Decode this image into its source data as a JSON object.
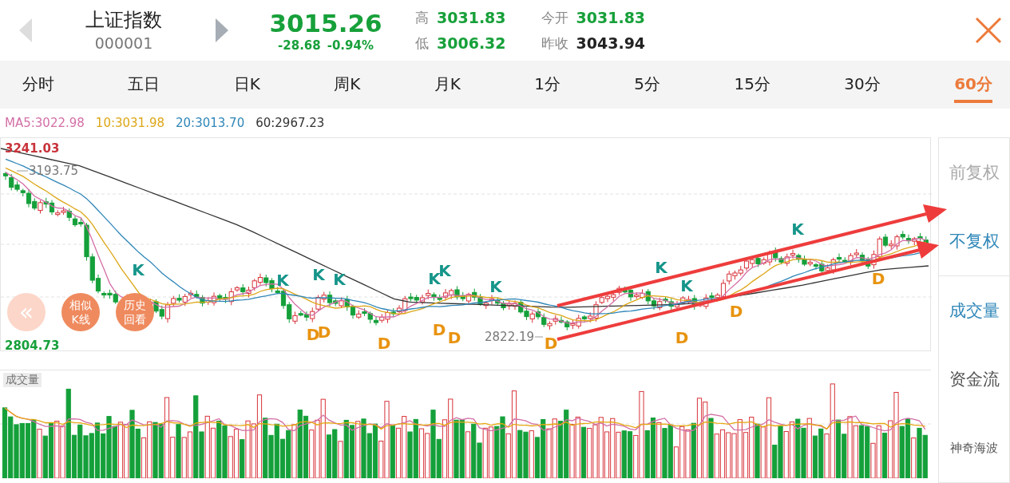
{
  "header": {
    "prev": {
      "disabled": true
    },
    "next": {
      "disabled": false
    },
    "name": "上证指数",
    "code": "000001",
    "price": "3015.26",
    "change": "-28.68",
    "change_pct": "-0.94%",
    "stats": [
      {
        "label": "高",
        "value": "3031.83",
        "color": "#17a03a"
      },
      {
        "label": "低",
        "value": "3006.32",
        "color": "#17a03a"
      },
      {
        "label": "今开",
        "value": "3031.83",
        "color": "#17a03a"
      },
      {
        "label": "昨收",
        "value": "3043.94",
        "color": "#222222"
      }
    ]
  },
  "tabs": [
    {
      "label": "分时",
      "selected": false
    },
    {
      "label": "五日",
      "selected": false
    },
    {
      "label": "日K",
      "selected": false
    },
    {
      "label": "周K",
      "selected": false
    },
    {
      "label": "月K",
      "selected": false
    },
    {
      "label": "1分",
      "selected": false
    },
    {
      "label": "5分",
      "selected": false
    },
    {
      "label": "15分",
      "selected": false
    },
    {
      "label": "30分",
      "selected": false
    },
    {
      "label": "60分",
      "selected": true
    }
  ],
  "ma_legend": [
    {
      "label": "MA5:3022.98",
      "color": "#d36fa6"
    },
    {
      "label": "10:3031.98",
      "color": "#dca616"
    },
    {
      "label": "20:3013.70",
      "color": "#2f86b8"
    },
    {
      "label": "60:2967.23",
      "color": "#333333"
    }
  ],
  "chart": {
    "max_label": "3241.03",
    "min_label": "2804.73",
    "high_note": "3193.75",
    "low_note": "2822.19",
    "signals": [
      {
        "label": "K",
        "color": "#16958a"
      },
      {
        "label": "K",
        "color": "#16958a"
      },
      {
        "label": "D",
        "color": "#e8930f"
      },
      {
        "label": "K",
        "color": "#16958a"
      },
      {
        "label": "D",
        "color": "#e8930f"
      },
      {
        "label": "K",
        "color": "#16958a"
      },
      {
        "label": "D",
        "color": "#e8930f"
      },
      {
        "label": "K",
        "color": "#16958a"
      },
      {
        "label": "D",
        "color": "#e8930f"
      },
      {
        "label": "K",
        "color": "#16958a"
      },
      {
        "label": "D",
        "color": "#e8930f"
      },
      {
        "label": "K",
        "color": "#16958a"
      },
      {
        "label": "D",
        "color": "#e8930f"
      },
      {
        "label": "K",
        "color": "#16958a"
      },
      {
        "label": "K",
        "color": "#16958a"
      },
      {
        "label": "D",
        "color": "#e8930f"
      },
      {
        "label": "D",
        "color": "#e8930f"
      },
      {
        "label": "K",
        "color": "#16958a"
      },
      {
        "label": "D",
        "color": "#e8930f"
      }
    ],
    "overlay_buttons": [
      {
        "label": "«",
        "kind": "collapse"
      },
      {
        "label": "相似K线",
        "kind": "action"
      },
      {
        "label": "历史回看",
        "kind": "action"
      }
    ]
  },
  "volume": {
    "label": "成交量"
  },
  "sidebar": {
    "adjust": [
      {
        "label": "前复权",
        "selected": false
      },
      {
        "label": "不复权",
        "selected": true
      }
    ],
    "indicators": [
      {
        "label": "成交量",
        "selected": true
      },
      {
        "label": "资金流",
        "selected": false
      }
    ],
    "extra": "神奇海波"
  }
}
